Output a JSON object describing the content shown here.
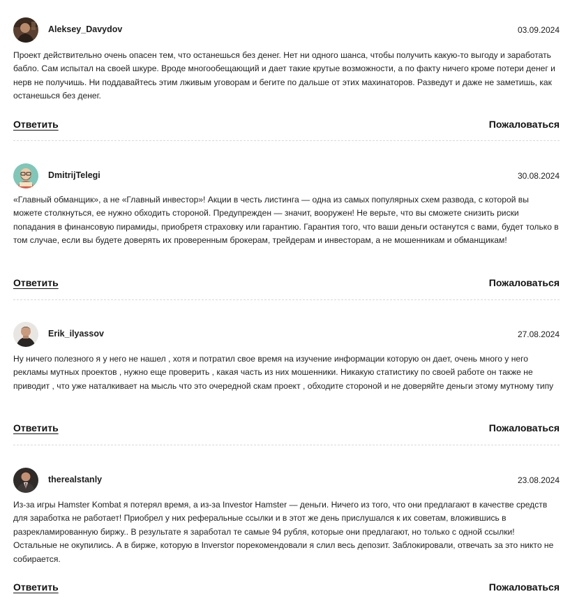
{
  "comments": [
    {
      "author": "Aleksey_Davydov",
      "date": "03.09.2024",
      "avatar": "avatar-man-dark-hair",
      "text": "Проект действительно очень опасен тем, что останешься без денег. Нет ни одного шанса, чтобы получить какую-то выгоду и заработать бабло. Сам испытал на своей шкуре. Вроде многообещающий и дает такие крутые возможности, а по факту ничего кроме потери денег и нерв не получишь. Ни поддавайтесь этим лживым уговорам и бегите по дальше от этих махинаторов. Разведут и даже не заметишь, как останешься без денег.",
      "reply_label": "Ответить",
      "report_label": "Пожаловаться"
    },
    {
      "author": "DmitrijTelegi",
      "date": "30.08.2024",
      "avatar": "avatar-cartoon-bearded-man",
      "text": "«Главный обманщик», а не «Главный инвестор»! Акции в честь листинга — одна из самых популярных схем развода, с которой вы можете столкнуться, ее нужно обходить стороной. Предупрежден — значит, вооружен! Не верьте, что вы сможете снизить риски попадания в финансовую пирамиды, приобретя страховку или гарантию. Гарантия того, что ваши деньги останутся с вами, будет только в том случае, если вы будете доверять их проверенным брокерам, трейдерам и инвесторам, а не мошенникам и обманщикам!",
      "reply_label": "Ответить",
      "report_label": "Пожаловаться"
    },
    {
      "author": "Erik_ilyassov",
      "date": "27.08.2024",
      "avatar": "avatar-man-dark-shirt",
      "text": "Ну ничего полезного я у него не нашел , хотя и потратил свое время на изучение информации которую он дает, очень много у него рекламы мутных проектов , нужно еще проверить , какая часть из них мошенники. Никакую статистику по своей работе он также не приводит , что уже наталкивает на мысль что это очередной скам проект , обходите стороной и не доверяйте деньги этому мутному типу",
      "reply_label": "Ответить",
      "report_label": "Пожаловаться"
    },
    {
      "author": "therealstanly",
      "date": "23.08.2024",
      "avatar": "avatar-man-in-suit",
      "text": "Из-за игры Hamster Kombat я потерял время, а из-за Investor Hamster — деньги. Ничего из того, что они предлагают в качестве средств для заработка не работает! Приобрел у них реферальные ссылки и в этот же день прислушался к их советам, вложившись в разрекламированную биржу.. В результате я заработал те самые 94 рубля, которые они предлагают, но только с одной ссылки! Остальные не окупились. А в бирже, которую в Inverstor порекомендовали я слил весь депозит. Заблокировали, отвечать за это никто не собирается.",
      "reply_label": "Ответить",
      "report_label": "Пожаловаться"
    }
  ]
}
